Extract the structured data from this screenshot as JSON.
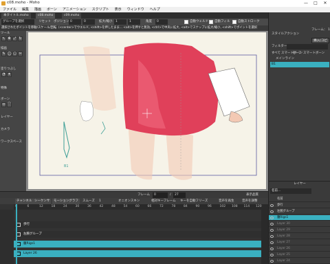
{
  "window": {
    "title": "c08.moho - Moho",
    "minimize": "—",
    "maximize": "□",
    "close": "✕"
  },
  "menu": [
    "ファイル",
    "編集",
    "描画",
    "ボーン",
    "アニメーション",
    "スクリプト",
    "表示",
    "ウィンドウ",
    "ヘルプ"
  ],
  "doc_tabs": [
    "本タイトル.moho",
    "c08.moho",
    "c09.moho"
  ],
  "tool_options": {
    "group_select": "グループを選択",
    "reset": "リセット",
    "position_label": "ポジション",
    "position_x": "0",
    "position_y": "0",
    "scale_label": "拡大/縮小",
    "scale_x": "1",
    "scale_y": "1",
    "angle_label": "角度",
    "angle_value": "0",
    "auto_weld": "自動ウェルド",
    "auto_fill": "自動フィル",
    "auto_stroke": "自動ストローク"
  },
  "hint": "選択されたポイントを移動/スケール/回転（<center>でウエルド, <shift>を押したまま... <alt>を押すと無効, <ctrl>で中央に拡大, <alt>でスナップに拡大/縮小, <shift>でポイントを選択",
  "toolbox": {
    "sections": [
      "ツール",
      "描画",
      "塗りつぶし",
      "特殊",
      "ボーン",
      "レイヤー",
      "カメラ",
      "ワークスペース"
    ],
    "tool_glyphs": [
      "↖",
      "✥",
      "⤢",
      "↻",
      "✎",
      "◯",
      "▢",
      "✂",
      "◔",
      "✦",
      "⬭",
      "⌒"
    ]
  },
  "canvas": {
    "shape_label": "B1",
    "accent_pink": "#e0405a",
    "skin": "#f3c9b4",
    "line_teal": "#3c9e96"
  },
  "status": {
    "frame_label": "フレーム",
    "frame_value": "0",
    "of_label": "/",
    "total_frames": "27",
    "display_quality": "表示品質"
  },
  "timeline": {
    "tabs": [
      "チャンネル",
      "シーケンサ",
      "モーショングラフ"
    ],
    "options": [
      "スムーズ",
      "1",
      "オニオンスキン",
      "相対キーフレーム",
      "キーを自動フリーズ",
      "音声を再生",
      "音声を調整"
    ],
    "ruler_ticks": [
      "0",
      "6",
      "12",
      "18",
      "24",
      "30",
      "36",
      "42",
      "48",
      "54",
      "60",
      "66",
      "72",
      "78",
      "84",
      "90",
      "96",
      "102",
      "108",
      "114",
      "120"
    ],
    "rows": [
      {
        "label": "歩行",
        "selected": false
      },
      {
        "label": "左腕グループ",
        "selected": false
      },
      {
        "label": "腹Rigs1",
        "selected": true
      },
      {
        "label": "Layer 26",
        "selected": true
      }
    ]
  },
  "right_panel": {
    "style_tab": "スタイル",
    "actions_tab": "アクション",
    "frame_label": "フレーム：",
    "frame_value": "1",
    "insert_copy": "挿入(コピー)",
    "filter_label": "フィルター：",
    "sub_tabs": [
      "すべて",
      "スマートボーン",
      "モーフ",
      "スマートボーン"
    ],
    "main_line": "メインライン",
    "selected_item": "B1"
  },
  "layers": {
    "title": "レイヤー",
    "name_field": "名前...",
    "header_name": "名前",
    "rows": [
      {
        "name": "歩行",
        "state": "normal"
      },
      {
        "name": "左腕グループ",
        "state": "normal"
      },
      {
        "name": "腹Rigs1",
        "state": "selected"
      },
      {
        "name": "Layer 30",
        "state": "dim"
      },
      {
        "name": "Layer 29",
        "state": "dim"
      },
      {
        "name": "Layer 28",
        "state": "dim"
      },
      {
        "name": "Layer 27",
        "state": "dim"
      },
      {
        "name": "Layer 26",
        "state": "dim"
      },
      {
        "name": "Layer 25",
        "state": "dim"
      },
      {
        "name": "Layer 24",
        "state": "dim"
      }
    ]
  }
}
